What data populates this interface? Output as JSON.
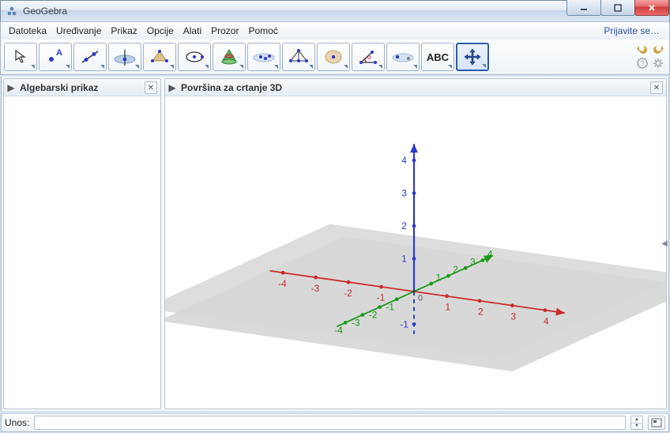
{
  "app": {
    "title": "GeoGebra"
  },
  "menus": {
    "items": [
      "Datoteka",
      "Uređivanje",
      "Prikaz",
      "Opcije",
      "Alati",
      "Prozor",
      "Pomoć"
    ],
    "signin": "Prijavite se…"
  },
  "toolbar": {
    "tools": [
      {
        "name": "move-tool",
        "icon": "arrow"
      },
      {
        "name": "point-tool",
        "icon": "point"
      },
      {
        "name": "line-tool",
        "icon": "line"
      },
      {
        "name": "perpendicular-tool",
        "icon": "perpline"
      },
      {
        "name": "polygon-tool",
        "icon": "polygon"
      },
      {
        "name": "circle-tool",
        "icon": "circle"
      },
      {
        "name": "intersect-surfaces-tool",
        "icon": "cone"
      },
      {
        "name": "sphere-tool",
        "icon": "sphere"
      },
      {
        "name": "plane-tool",
        "icon": "plane3pt"
      },
      {
        "name": "pyramid-tool",
        "icon": "pyramid"
      },
      {
        "name": "angle-tool",
        "icon": "angle"
      },
      {
        "name": "reflect-tool",
        "icon": "reflect"
      },
      {
        "name": "text-tool",
        "icon": "abc",
        "label": "ABC"
      },
      {
        "name": "move-view-tool",
        "icon": "movecross",
        "selected": true
      }
    ]
  },
  "panels": {
    "algebra": {
      "title": "Algebarski prikaz"
    },
    "view3d": {
      "title": "Površina za crtanje 3D"
    }
  },
  "input": {
    "label": "Unos:",
    "value": ""
  },
  "chart_data": {
    "type": "3d-axes",
    "axes": {
      "x": {
        "color": "#cc2a2a",
        "range": [
          -4,
          4
        ],
        "ticks": [
          -4,
          -3,
          -2,
          -1,
          0,
          1,
          2,
          3,
          4
        ]
      },
      "y": {
        "color": "#1a9a1a",
        "range": [
          -4,
          4
        ],
        "ticks": [
          -4,
          -3,
          -2,
          -1,
          0,
          1,
          2,
          3,
          4
        ]
      },
      "z": {
        "color": "#2a3acc",
        "range": [
          -1,
          4
        ],
        "ticks": [
          -1,
          0,
          1,
          2,
          3,
          4
        ],
        "negative_dashed": true
      }
    },
    "ground_plane": true,
    "origin_label": "0"
  }
}
